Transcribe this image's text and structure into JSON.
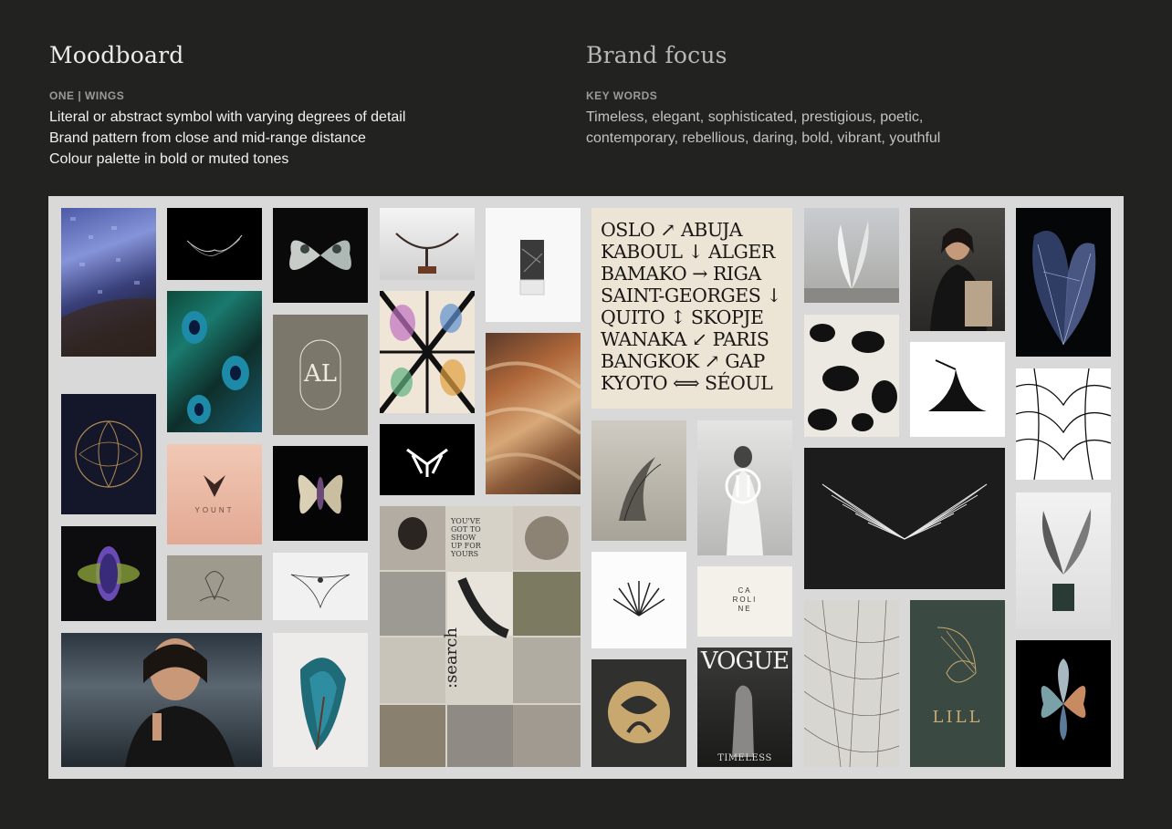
{
  "left": {
    "title": "Moodboard",
    "subtitle": "ONE | WINGS",
    "lines": [
      "Literal or abstract symbol with varying degrees of detail",
      "Brand pattern from close and mid-range distance",
      "Colour palette in bold or muted tones"
    ]
  },
  "right": {
    "title": "Brand focus",
    "subtitle": "KEY WORDS",
    "lines": [
      "Timeless, elegant, sophisticated, prestigious, poetic,",
      "contemporary, rebellious, daring, bold, vibrant, youthful"
    ]
  },
  "tiles": {
    "monogram_al": "AL",
    "yount": "YOUNT",
    "poster_lines": [
      "OSLO ↗ ABUJA",
      "KABOUL ↓ ALGER",
      "BAMAKO → RIGA",
      "SAINT-GEORGES ↓",
      "QUITO ↕ SKOPJE",
      "WANAKA ↙ PARIS",
      "BANGKOK ↗ GAP",
      "KYOTO ⟺ SÉOUL"
    ],
    "caroline": [
      "CA",
      "ROLI",
      "NE"
    ],
    "vogue": "VOGUE",
    "vogue_sub": "TIMELESS",
    "lill": "LILL",
    "search": ":search",
    "collage_text": [
      "YOU'VE",
      "GOT TO",
      "SHOW",
      "UP FOR",
      "YOURS"
    ]
  },
  "colors": {
    "background": "#222220",
    "board": "#d9d9d9",
    "title": "#ecebe6",
    "brand_title": "#b8b7b2",
    "keyword_text": "#c4c3be"
  }
}
